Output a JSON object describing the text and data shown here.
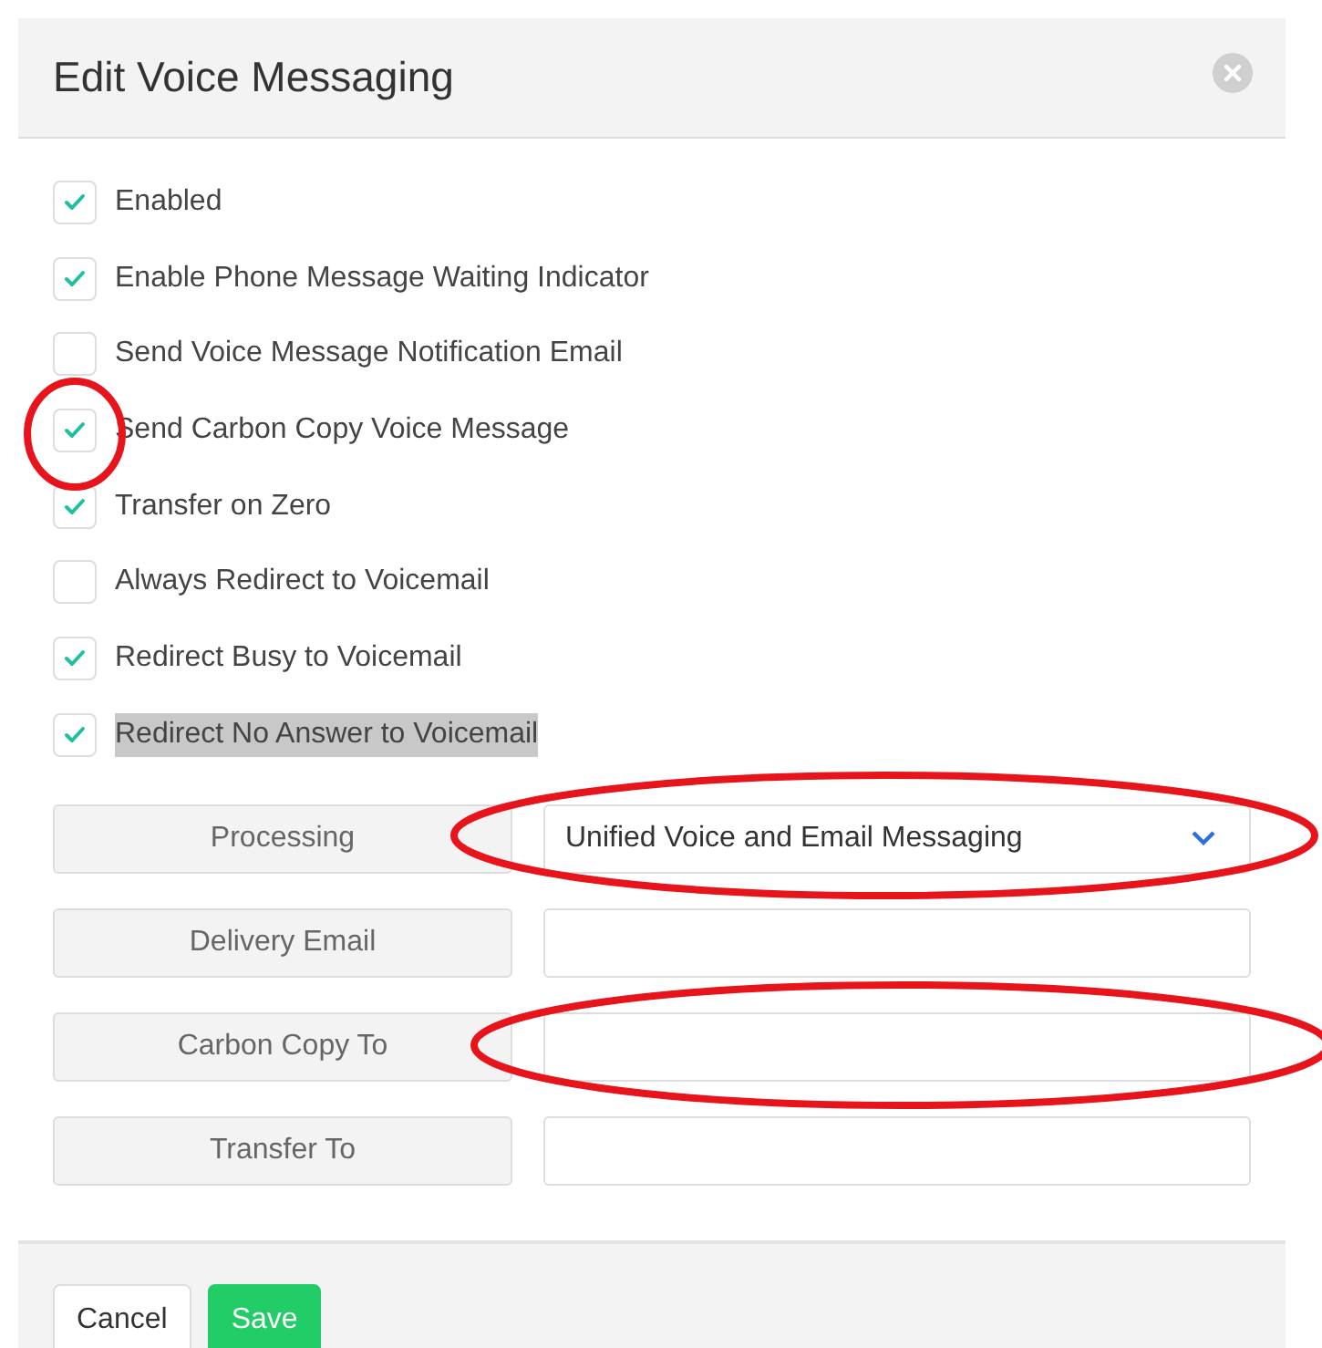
{
  "dialog": {
    "title": "Edit Voice Messaging"
  },
  "options": [
    {
      "label": "Enabled",
      "checked": true,
      "highlighted": false
    },
    {
      "label": "Enable Phone Message Waiting Indicator",
      "checked": true,
      "highlighted": false
    },
    {
      "label": "Send Voice Message Notification Email",
      "checked": false,
      "highlighted": false
    },
    {
      "label": "Send Carbon Copy Voice Message",
      "checked": true,
      "highlighted": false
    },
    {
      "label": "Transfer on Zero",
      "checked": true,
      "highlighted": false
    },
    {
      "label": "Always Redirect to Voicemail",
      "checked": false,
      "highlighted": false
    },
    {
      "label": "Redirect Busy to Voicemail",
      "checked": true,
      "highlighted": false
    },
    {
      "label": "Redirect No Answer to Voicemail",
      "checked": true,
      "highlighted": true
    }
  ],
  "fields": [
    {
      "label": "Processing",
      "kind": "select",
      "value": "Unified Voice and Email Messaging"
    },
    {
      "label": "Delivery Email",
      "kind": "text"
    },
    {
      "label": "Carbon Copy To",
      "kind": "text"
    },
    {
      "label": "Transfer To",
      "kind": "text"
    }
  ],
  "buttons": [
    {
      "label": "Cancel",
      "kind": "secondary"
    },
    {
      "label": "Save",
      "kind": "primary"
    }
  ]
}
